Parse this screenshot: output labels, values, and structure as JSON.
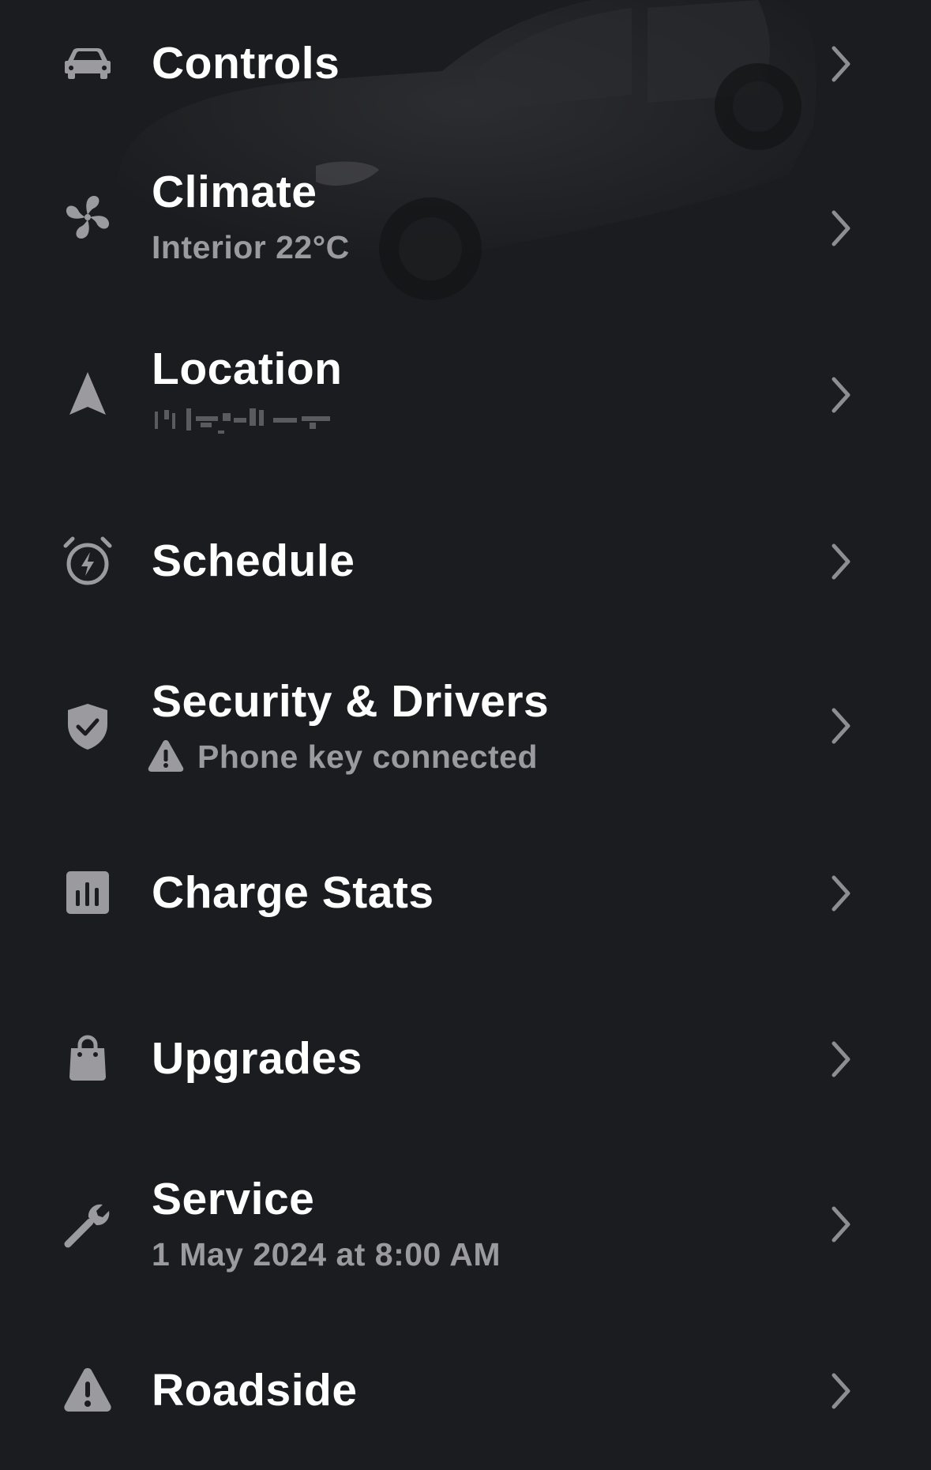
{
  "colors": {
    "background": "#1b1c1f",
    "title": "#ffffff",
    "subtitle": "#9a9a9f",
    "icon": "#9a9a9f",
    "chevron": "#8d8d92"
  },
  "menu": {
    "controls": {
      "title": "Controls",
      "icon": "car-icon"
    },
    "climate": {
      "title": "Climate",
      "subtitle": "Interior 22°C",
      "icon": "fan-icon"
    },
    "location": {
      "title": "Location",
      "icon": "navigation-arrow-icon"
    },
    "schedule": {
      "title": "Schedule",
      "icon": "alarm-clock-bolt-icon"
    },
    "security": {
      "title": "Security & Drivers",
      "subtitle": "Phone key connected",
      "icon": "shield-check-icon",
      "subtitle_icon": "warning-icon"
    },
    "charge_stats": {
      "title": "Charge Stats",
      "icon": "bar-chart-icon"
    },
    "upgrades": {
      "title": "Upgrades",
      "icon": "shopping-bag-icon"
    },
    "service": {
      "title": "Service",
      "subtitle": "1 May 2024 at 8:00 AM",
      "icon": "wrench-icon"
    },
    "roadside": {
      "title": "Roadside",
      "icon": "warning-triangle-icon"
    }
  }
}
